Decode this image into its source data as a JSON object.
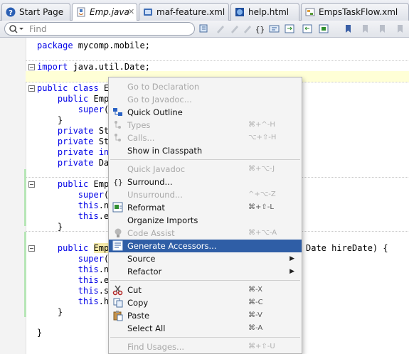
{
  "tabs": [
    {
      "label": "Start Page",
      "icon": "help-icon",
      "active": false
    },
    {
      "label": "Emp.java",
      "icon": "java-file-icon",
      "active": true
    },
    {
      "label": "maf-feature.xml",
      "icon": "xml-file-icon",
      "active": false
    },
    {
      "label": "help.html",
      "icon": "html-file-icon",
      "active": false
    },
    {
      "label": "EmpsTaskFlow.xml",
      "icon": "taskflow-icon",
      "active": false
    }
  ],
  "toolbar": {
    "search_placeholder": "Find",
    "search_icon": "search-icon"
  },
  "code": {
    "line_package": "package mycomp.mobile;",
    "line_import_kw": "import",
    "line_import_rest": " java.util.Date;",
    "line_class": "public class Em",
    "line_ctor1": "    public Emp",
    "line_super1": "        super(",
    "line_brace1": "    }",
    "line_f1": "    private St",
    "line_f2": "    private St",
    "line_f3": "    private int",
    "line_f4": "    private Dat",
    "line_ctor2": "    public Emp",
    "line_super2": "        super(",
    "line_this1": "        this.na",
    "line_this2": "        this.em",
    "line_brace2": "    }",
    "line_ctor3": "    public Emp",
    "line_ctor3_tail": "Date hireDate) {",
    "line_super3": "        super(",
    "line_this3": "        this.na",
    "line_this4": "        this.em",
    "line_this5": "        this.sa",
    "line_this6": "        this.hi",
    "line_brace3": "    }",
    "line_brace4": "}"
  },
  "menu": {
    "items": [
      {
        "label": "Go to Declaration",
        "shortcut": "",
        "disabled": true
      },
      {
        "label": "Go to Javadoc...",
        "shortcut": "",
        "disabled": true
      },
      {
        "label": "Quick Outline",
        "shortcut": "",
        "disabled": false,
        "icon": "quick-outline-icon"
      },
      {
        "label": "Types",
        "shortcut": "⌘+^-H",
        "disabled": true,
        "icon": "type-hierarchy-icon"
      },
      {
        "label": "Calls...",
        "shortcut": "⌥+⇧-H",
        "disabled": true,
        "icon": "call-hierarchy-icon"
      },
      {
        "label": "Show in Classpath",
        "shortcut": "",
        "disabled": false
      },
      {
        "label": "Quick Javadoc",
        "shortcut": "⌘+⌥-J",
        "disabled": true
      },
      {
        "label": "Surround...",
        "shortcut": "",
        "disabled": false,
        "icon": "surround-braces-icon"
      },
      {
        "label": "Unsurround...",
        "shortcut": "^+⌥-Z",
        "disabled": true
      },
      {
        "label": "Reformat",
        "shortcut": "⌘+⇧-L",
        "disabled": false,
        "icon": "reformat-icon"
      },
      {
        "label": "Organize Imports",
        "shortcut": "",
        "disabled": false
      },
      {
        "label": "Code Assist",
        "shortcut": "⌘+⌥-A",
        "disabled": true,
        "icon": "lightbulb-icon"
      },
      {
        "label": "Generate Accessors...",
        "shortcut": "",
        "disabled": false,
        "selected": true,
        "icon": "generate-accessors-icon"
      },
      {
        "label": "Source",
        "shortcut": "",
        "disabled": false,
        "submenu": true
      },
      {
        "label": "Refactor",
        "shortcut": "",
        "disabled": false,
        "submenu": true
      },
      {
        "label": "Cut",
        "shortcut": "⌘-X",
        "disabled": false,
        "icon": "scissors-icon"
      },
      {
        "label": "Copy",
        "shortcut": "⌘-C",
        "disabled": false,
        "icon": "copy-icon"
      },
      {
        "label": "Paste",
        "shortcut": "⌘-V",
        "disabled": false,
        "icon": "paste-icon"
      },
      {
        "label": "Select All",
        "shortcut": "⌘-A",
        "disabled": false
      },
      {
        "label": "Find Usages...",
        "shortcut": "⌘+⇧-U",
        "disabled": true
      }
    ],
    "highlight_color": "#2f5ea6"
  },
  "colors": {
    "keyword": "#0000e6",
    "change_bar": "#b6e6b6",
    "current_line": "#ffffd6"
  }
}
